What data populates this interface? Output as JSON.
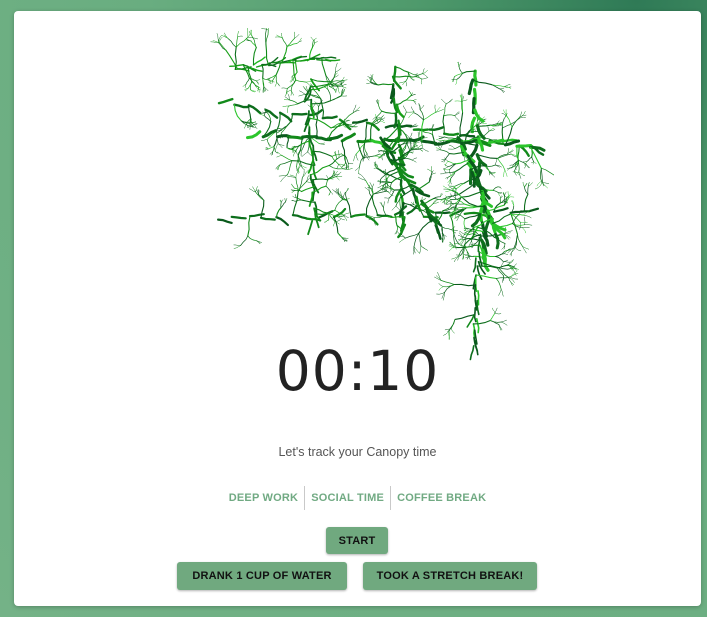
{
  "timer": {
    "display": "00:10"
  },
  "tagline": "Let's track your Canopy time",
  "modes": [
    {
      "label": "DEEP WORK"
    },
    {
      "label": "SOCIAL TIME"
    },
    {
      "label": "COFFEE BREAK"
    }
  ],
  "controls": {
    "start_label": "START",
    "water_label": "DRANK 1 CUP OF WATER",
    "stretch_label": "TOOK A STRETCH BREAK!"
  },
  "colors": {
    "accent": "#70a97f",
    "vine_light": "#22c422",
    "vine_dark": "#0a5a1c"
  }
}
